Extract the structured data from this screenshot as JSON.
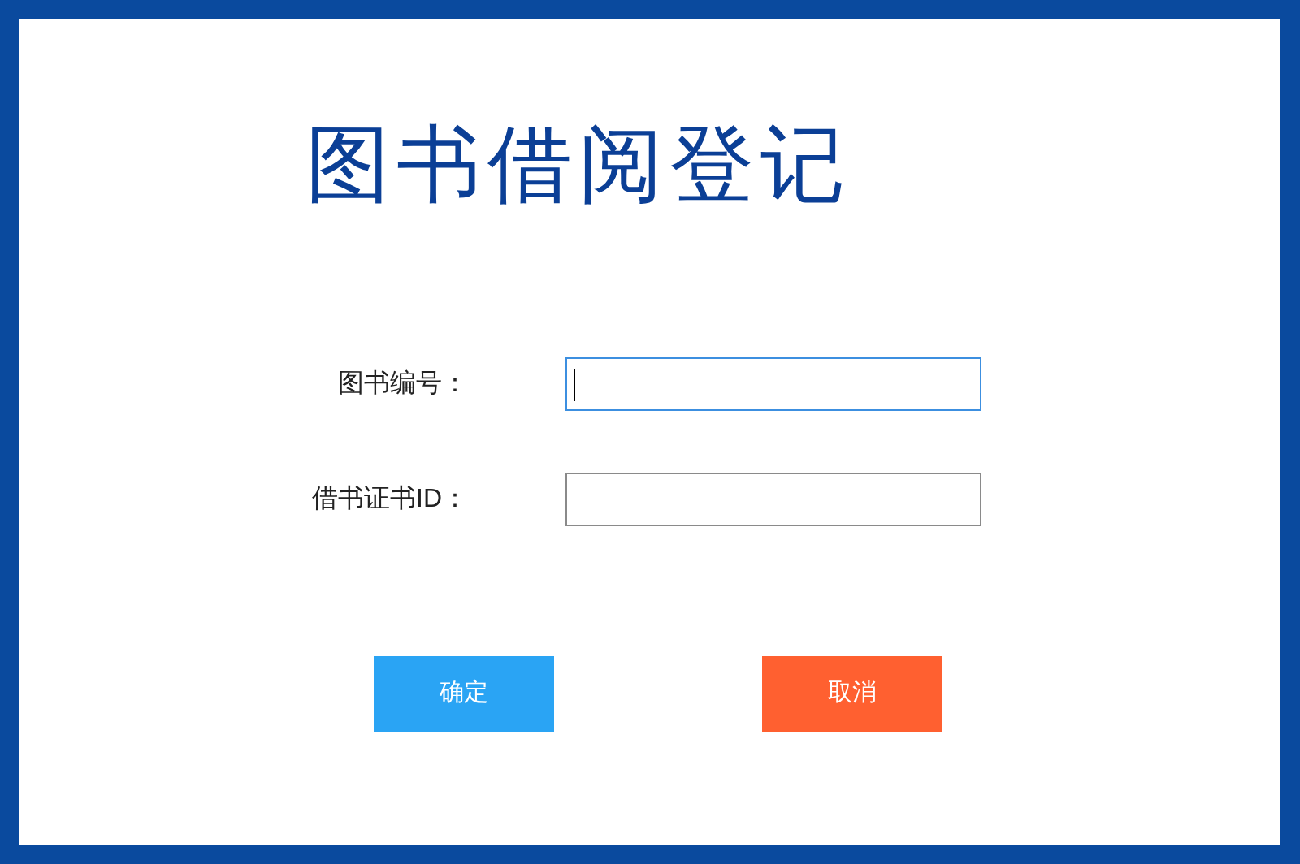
{
  "title": "图书借阅登记",
  "fields": [
    {
      "label": "图书编号：",
      "focused": true
    },
    {
      "label": "借书证书ID：",
      "focused": false
    }
  ],
  "buttons": [
    {
      "label": "确定",
      "kind": "confirm"
    },
    {
      "label": "取消",
      "kind": "cancel"
    }
  ]
}
